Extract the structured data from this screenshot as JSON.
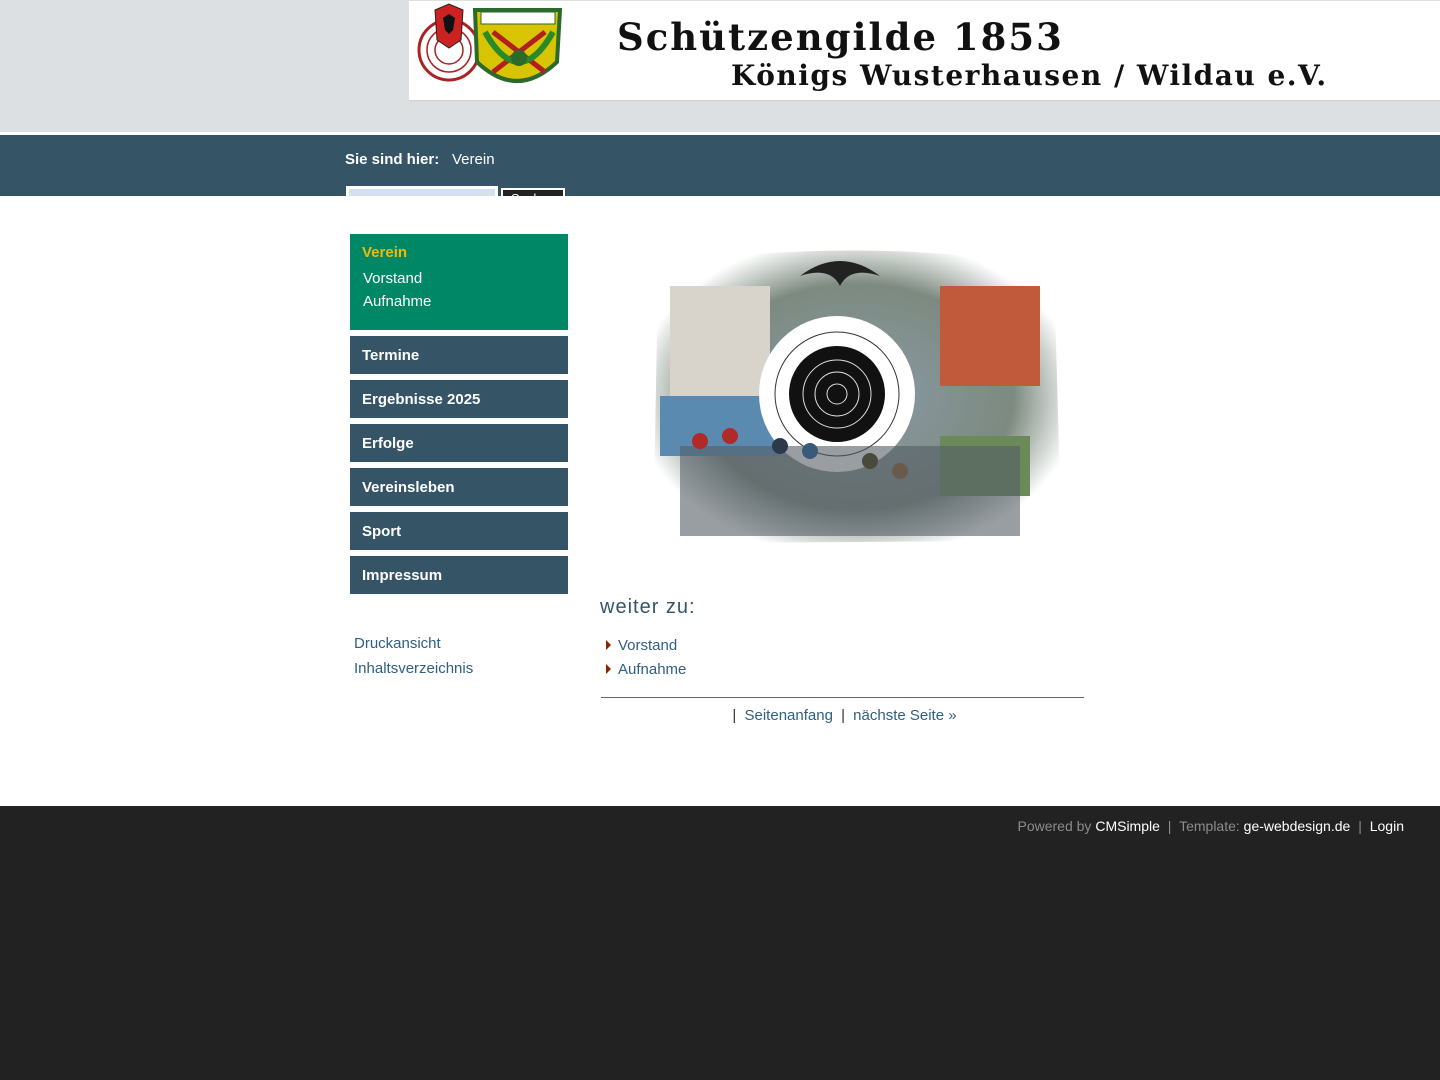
{
  "header": {
    "title_line1": "Schützengilde 1853",
    "title_line2": "Königs Wusterhausen / Wildau e.V."
  },
  "breadcrumb": {
    "label": "Sie sind hier:",
    "current": "Verein"
  },
  "search": {
    "value": "",
    "placeholder": "",
    "button_label": "Suchen"
  },
  "menu": {
    "active": {
      "label": "Verein",
      "subitems": [
        "Vorstand",
        "Aufnahme"
      ]
    },
    "items": [
      "Termine",
      "Ergebnisse 2025",
      "Erfolge",
      "Vereinsleben",
      "Sport",
      "Impressum"
    ]
  },
  "sidebar_links": {
    "print": "Druckansicht",
    "sitemap": "Inhaltsverzeichnis"
  },
  "main": {
    "next_heading": "weiter zu:",
    "next_links": [
      "Vorstand",
      "Aufnahme"
    ],
    "pager": {
      "separator": "|",
      "top": "Seitenanfang",
      "next": "nächste Seite »"
    }
  },
  "footer": {
    "powered_by": "Powered by",
    "cms": "CMSimple",
    "separator": "|",
    "template_label": "Template:",
    "template_link": "ge-webdesign.de",
    "login": "Login"
  },
  "colors": {
    "navbar": "#355566",
    "active_menu": "#008866",
    "active_menu_text": "#f5b800",
    "link": "#2f5f82",
    "footer_bg": "#222222"
  },
  "icons": {
    "list_bullet": "arrow-right-icon",
    "logo": "club-crest-logo"
  }
}
